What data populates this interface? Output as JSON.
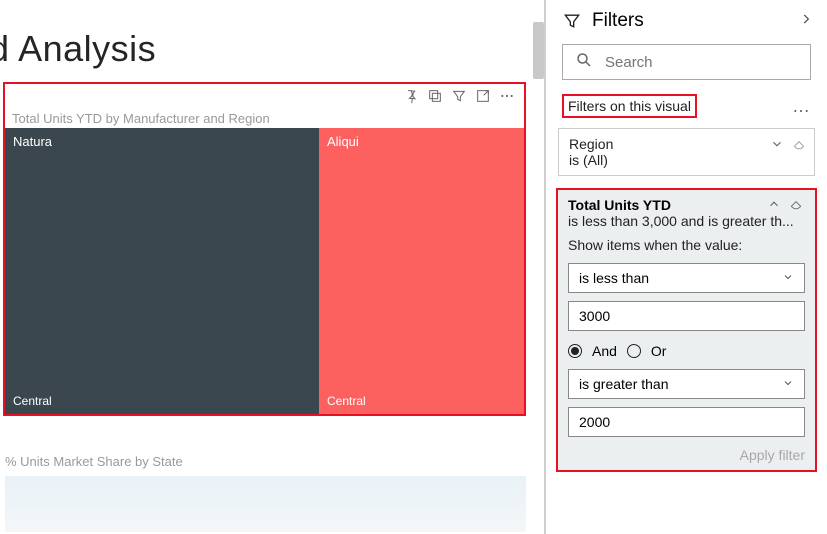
{
  "page": {
    "title": "end Analysis"
  },
  "visual": {
    "title": "Total Units YTD by Manufacturer and Region",
    "cells": [
      {
        "name": "Natura",
        "region": "Central"
      },
      {
        "name": "Aliqui",
        "region": "Central"
      }
    ]
  },
  "secondary_visual": {
    "title": "% Units Market Share by State"
  },
  "filters": {
    "header": "Filters",
    "search_placeholder": "Search",
    "section_label": "Filters on this visual",
    "region_card": {
      "field": "Region",
      "summary": "is (All)"
    },
    "adv_card": {
      "field": "Total Units YTD",
      "summary": "is less than 3,000 and is greater th...",
      "show_label": "Show items when the value:",
      "op1": "is less than",
      "val1": "3000",
      "logic_and": "And",
      "logic_or": "Or",
      "logic_selected": "and",
      "op2": "is greater than",
      "val2": "2000",
      "apply_label": "Apply filter"
    }
  }
}
